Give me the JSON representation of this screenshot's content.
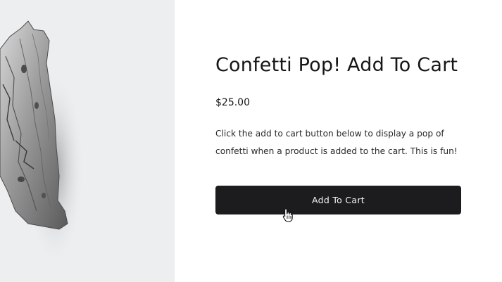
{
  "product": {
    "title": "Confetti Pop! Add To Cart",
    "price": "$25.00",
    "description": "Click the add to cart button below to display a pop of confetti when a product is added to the cart. This is fun!",
    "add_to_cart_label": "Add To Cart",
    "image_alt": "driftwood"
  },
  "colors": {
    "button_bg": "#1c1b1e",
    "button_text": "#f4f4f4",
    "image_bg": "#eceef0"
  },
  "icons": {
    "cursor": "hand-pointer-icon"
  }
}
